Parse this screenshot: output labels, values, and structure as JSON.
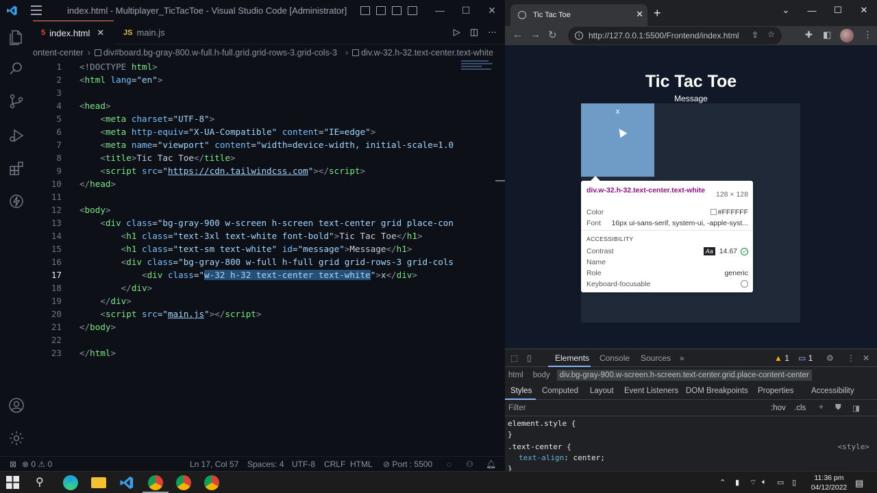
{
  "vscode": {
    "window_title": "index.html - Multiplayer_TicTacToe - Visual Studio Code [Administrator]",
    "tabs": [
      {
        "label": "index.html",
        "icon": "html-file-icon",
        "active": true
      },
      {
        "label": "main.js",
        "icon": "js-file-icon",
        "active": false
      }
    ],
    "tab_icon_html": "5",
    "tab_icon_js": "JS",
    "breadcrumbs": {
      "part1": "ontent-center",
      "part2": "div#board.bg-gray-800.w-full.h-full.grid.grid-rows-3.grid-cols-3",
      "part3": "div.w-32.h-32.text-center.text-white"
    },
    "code": {
      "l1": {
        "n": "1",
        "a": "<!DOCTYPE ",
        "b": "html",
        "c": ">"
      },
      "l2": {
        "n": "2"
      },
      "l3": {
        "n": "3"
      },
      "l4": {
        "n": "4"
      },
      "l5": {
        "n": "5"
      },
      "l6": {
        "n": "6"
      },
      "l7": {
        "n": "7"
      },
      "l8": {
        "n": "8"
      },
      "l9": {
        "n": "9"
      },
      "l10": {
        "n": "10"
      },
      "l11": {
        "n": "11"
      },
      "l12": {
        "n": "12"
      },
      "l13": {
        "n": "13"
      },
      "l14": {
        "n": "14"
      },
      "l15": {
        "n": "15"
      },
      "l16": {
        "n": "16"
      },
      "l17": {
        "n": "17"
      },
      "l18": {
        "n": "18"
      },
      "l19": {
        "n": "19"
      },
      "l20": {
        "n": "20"
      },
      "l21": {
        "n": "21"
      },
      "l22": {
        "n": "22"
      },
      "l23": {
        "n": "23"
      }
    },
    "status": {
      "errors": "0",
      "warnings": "0",
      "position": "Ln 17, Col 57",
      "spaces": "Spaces: 4",
      "encoding": "UTF-8",
      "eol": "CRLF",
      "language": "HTML",
      "port": "Port : 5500"
    }
  },
  "browser": {
    "tab_title": "Tic Tac Toe",
    "url": "http://127.0.0.1:5500/Frontend/index.html",
    "page": {
      "title": "Tic Tac Toe",
      "message": "Message",
      "cell_text": "x"
    },
    "inspector_tooltip": {
      "selector": "div.w-32.h-32.text-center.text-white",
      "size": "128 × 128",
      "color_label": "Color",
      "color_value": "#FFFFFF",
      "font_label": "Font",
      "font_value": "16px ui-sans-serif, system-ui, -apple-syst...",
      "accessibility_heading": "ACCESSIBILITY",
      "contrast_label": "Contrast",
      "contrast_badge": "Aa",
      "contrast_value": "14.67",
      "name_label": "Name",
      "role_label": "Role",
      "role_value": "generic",
      "keyboard_label": "Keyboard-focusable"
    },
    "devtools": {
      "tabs": [
        "Elements",
        "Console",
        "Sources"
      ],
      "more": "»",
      "warnings": "1",
      "messages": "1",
      "breadcrumbs": [
        "html",
        "body",
        "div.bg-gray-900.w-screen.h-screen.text-center.grid.place-content-center"
      ],
      "subtabs": [
        "Styles",
        "Computed",
        "Layout",
        "Event Listeners",
        "DOM Breakpoints",
        "Properties",
        "Accessibility"
      ],
      "filter_placeholder": "Filter",
      "hov": ":hov",
      "cls": ".cls",
      "styles": {
        "element_style": "element.style {",
        "close1": "}",
        "rule_selector": ".text-center {",
        "rule_source": "<style>",
        "prop": "text-align",
        "value": "center;",
        "close2": "}"
      }
    }
  },
  "taskbar": {
    "time": "11:36 pm",
    "date": "04/12/2022"
  }
}
